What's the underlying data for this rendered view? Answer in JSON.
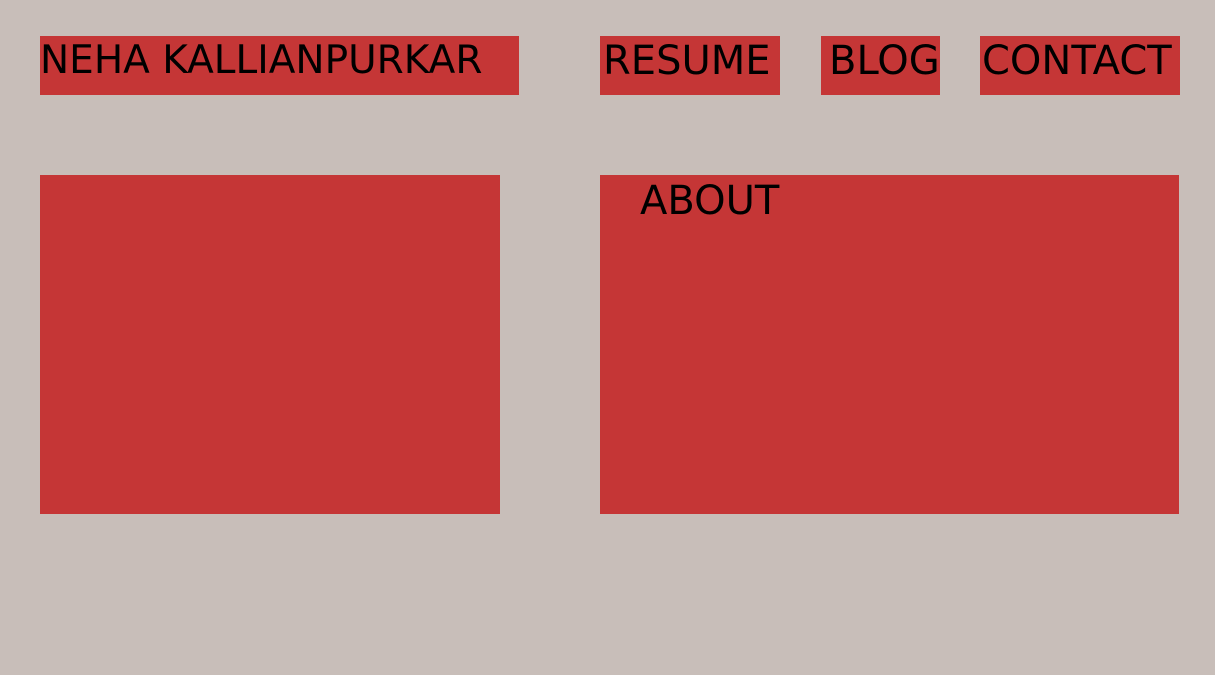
{
  "header": {
    "site_name": "NEHA KALLIANPURKAR",
    "nav": {
      "resume": "RESUME",
      "blog": "BLOG",
      "contact": "CONTACT"
    }
  },
  "main": {
    "about_heading": "ABOUT"
  },
  "colors": {
    "background": "#c8beb9",
    "accent": "#c53636",
    "text": "#000000"
  }
}
